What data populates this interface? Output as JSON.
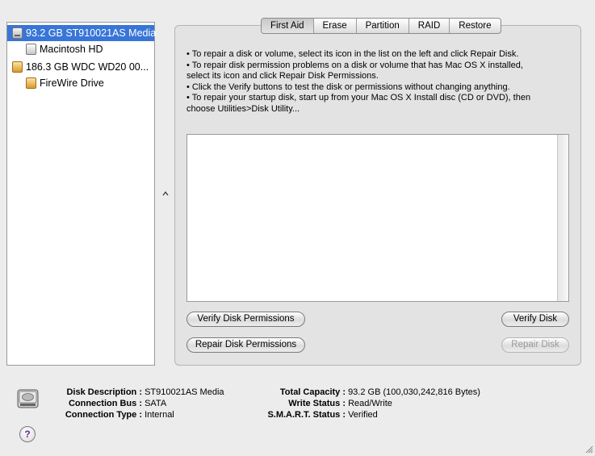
{
  "sidebar": {
    "items": [
      {
        "label": "93.2 GB ST910021AS Media",
        "icon": "internal-disk-icon",
        "selected": true
      },
      {
        "label": "Macintosh HD",
        "icon": "volume-icon"
      },
      {
        "label": "186.3 GB WDC WD20 00...",
        "icon": "firewire-disk-icon"
      },
      {
        "label": "FireWire Drive",
        "icon": "firewire-volume-icon"
      }
    ]
  },
  "tabs": [
    "First Aid",
    "Erase",
    "Partition",
    "RAID",
    "Restore"
  ],
  "active_tab": "First Aid",
  "instructions": [
    "• To repair a disk or volume, select its icon in the list on the left and click Repair Disk.",
    "• To repair disk permission problems on a disk or volume that has Mac OS X installed,",
    "select its icon and click Repair Disk Permissions.",
    "• Click the Verify buttons to test the disk or permissions without changing anything.",
    "• To repair your startup disk, start up from your Mac OS X Install disc (CD or DVD), then",
    "choose Utilities>Disk Utility..."
  ],
  "buttons": {
    "verify_permissions": "Verify Disk Permissions",
    "verify_disk": "Verify Disk",
    "repair_permissions": "Repair Disk Permissions",
    "repair_disk": "Repair Disk"
  },
  "info": {
    "disk_description_label": "Disk Description :",
    "disk_description": "ST910021AS Media",
    "connection_bus_label": "Connection Bus :",
    "connection_bus": "SATA",
    "connection_type_label": "Connection Type :",
    "connection_type": "Internal",
    "total_capacity_label": "Total Capacity :",
    "total_capacity": "93.2 GB (100,030,242,816 Bytes)",
    "write_status_label": "Write Status :",
    "write_status": "Read/Write",
    "smart_status_label": "S.M.A.R.T. Status :",
    "smart_status": "Verified"
  },
  "help_glyph": "?",
  "colors": {
    "selection": "#3875d7",
    "help_mark": "#6a2a9a"
  }
}
